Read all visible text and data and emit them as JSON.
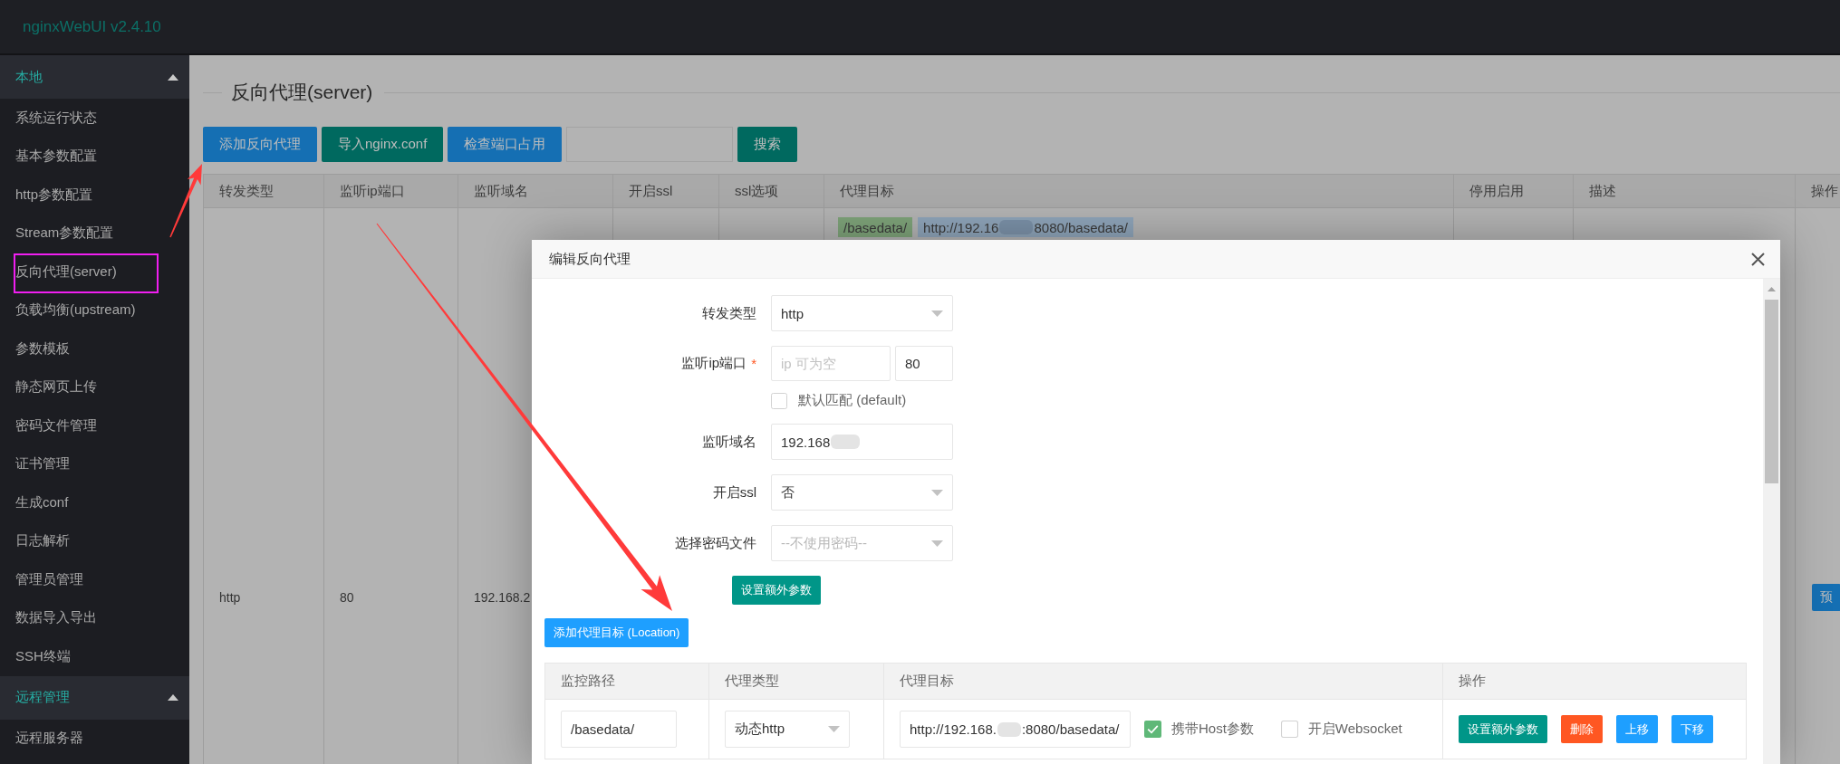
{
  "header": {
    "logo": "nginxWebUI v2.4.10"
  },
  "sidebar": {
    "sections": [
      {
        "title": "本地",
        "expanded": true,
        "items": [
          {
            "label": "系统运行状态",
            "highlighted": false
          },
          {
            "label": "基本参数配置",
            "highlighted": false
          },
          {
            "label": "http参数配置",
            "highlighted": false
          },
          {
            "label": "Stream参数配置",
            "highlighted": false
          },
          {
            "label": "反向代理(server)",
            "highlighted": true
          },
          {
            "label": "负载均衡(upstream)",
            "highlighted": false
          },
          {
            "label": "参数模板",
            "highlighted": false
          },
          {
            "label": "静态网页上传",
            "highlighted": false
          },
          {
            "label": "密码文件管理",
            "highlighted": false
          },
          {
            "label": "证书管理",
            "highlighted": false
          },
          {
            "label": "生成conf",
            "highlighted": false
          },
          {
            "label": "日志解析",
            "highlighted": false
          },
          {
            "label": "管理员管理",
            "highlighted": false
          },
          {
            "label": "数据导入导出",
            "highlighted": false
          },
          {
            "label": "SSH终端",
            "highlighted": false
          }
        ]
      },
      {
        "title": "远程管理",
        "expanded": true,
        "items": [
          {
            "label": "远程服务器",
            "highlighted": false
          }
        ]
      }
    ]
  },
  "page": {
    "title": "反向代理(server)",
    "toolbar": {
      "buttons": [
        {
          "label": "添加反向代理",
          "kind": "normal"
        },
        {
          "label": "导入nginx.conf",
          "kind": "default"
        },
        {
          "label": "检查端口占用",
          "kind": "normal"
        }
      ],
      "search_button": {
        "label": "搜索",
        "kind": "default"
      }
    },
    "table": {
      "columns": [
        "转发类型",
        "监听ip端口",
        "监听域名",
        "开启ssl",
        "ssl选项",
        "代理目标",
        "停用启用",
        "描述",
        "操作"
      ],
      "rows": [
        {
          "forward_type": "http",
          "listen_port": "80",
          "domain": "192.168.2",
          "proxy_targets": [
            {
              "path": "/basedata/",
              "url_start": "http://192.16",
              "url_end": "8080/basedata/",
              "blurred": true
            }
          ],
          "action_button": {
            "label": "预",
            "kind": "normal"
          }
        }
      ]
    }
  },
  "modal": {
    "title": "编辑反向代理",
    "form": [
      {
        "kind": "select",
        "label": "转发类型",
        "value": "http"
      },
      {
        "kind": "address",
        "label": "监听ip端口",
        "required_mark": "*",
        "ip_placeholder": "ip 可为空",
        "port_value": "80"
      },
      {
        "kind": "checkbox",
        "label": "默认匹配 (default)",
        "checked": false
      },
      {
        "kind": "text",
        "label": "监听域名",
        "value": "192.168",
        "blurred": true
      },
      {
        "kind": "select",
        "label": "开启ssl",
        "value": "否"
      },
      {
        "kind": "select",
        "label": "选择密码文件",
        "placeholder": "--不使用密码--"
      }
    ],
    "extra_button": {
      "label": "设置额外参数",
      "kind": "default"
    },
    "add_location_button": {
      "label": "添加代理目标 (Location)",
      "kind": "normal"
    },
    "locations": {
      "columns": [
        "监控路径",
        "代理类型",
        "代理目标",
        "操作"
      ],
      "rows": [
        {
          "path": "/basedata/",
          "proxy_type": "动态http",
          "target_start": "http://192.168.",
          "target_end": ":8080/basedata/",
          "blurred": true,
          "options": [
            {
              "label": "携带Host参数",
              "checked": true
            },
            {
              "label": "开启Websocket",
              "checked": false
            }
          ],
          "buttons": [
            {
              "label": "设置额外参数",
              "kind": "default"
            },
            {
              "label": "删除",
              "kind": "danger"
            },
            {
              "label": "上移",
              "kind": "normal"
            },
            {
              "label": "下移",
              "kind": "normal"
            }
          ]
        }
      ]
    }
  }
}
